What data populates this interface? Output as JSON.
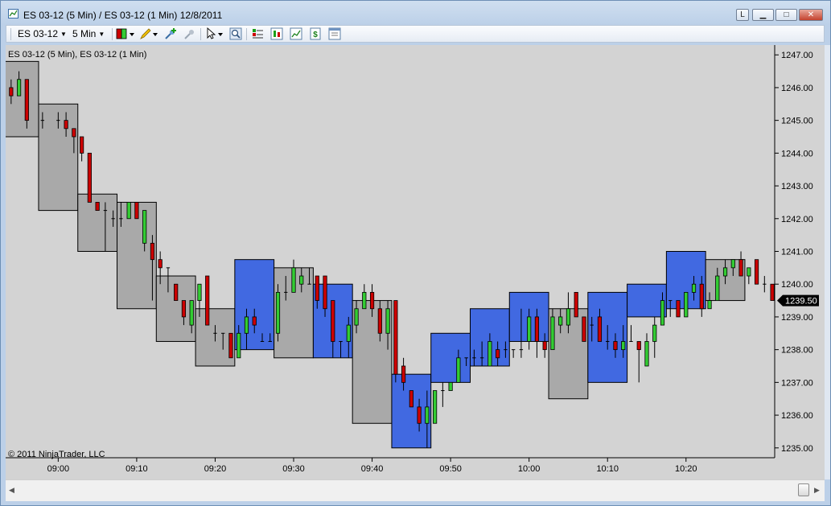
{
  "window": {
    "title": "ES 03-12 (5 Min) / ES 03-12 (1 Min)  12/8/2011",
    "buttons": {
      "link": "L",
      "minimize": "▁",
      "maximize": "□",
      "close": "✕"
    }
  },
  "toolbar": {
    "instrument": "ES 03-12",
    "interval": "5 Min",
    "icons": [
      "bar-style-icon",
      "pencil-drawing-icon",
      "add-indicator-icon",
      "remove-indicator-icon",
      "pointer-icon",
      "zoom-icon",
      "strategies-icon",
      "chart-trader-icon",
      "data-box-icon",
      "dollar-icon",
      "properties-icon"
    ]
  },
  "chart_data": {
    "type": "candlestick",
    "label": "ES 03-12 (5 Min), ES 03-12 (1 Min)",
    "copyright": "© 2011 NinjaTrader, LLC",
    "ylim": [
      1234.7,
      1247.3
    ],
    "y_ticks": [
      "1247.00",
      "1246.00",
      "1245.00",
      "1244.00",
      "1243.00",
      "1242.00",
      "1241.00",
      "1240.00",
      "1239.00",
      "1238.00",
      "1237.00",
      "1236.00",
      "1235.00"
    ],
    "x_ticks": [
      "09:00",
      "09:10",
      "09:20",
      "09:30",
      "09:40",
      "09:50",
      "10:00",
      "10:10",
      "10:20"
    ],
    "x_tick_minutes": [
      60,
      70,
      80,
      90,
      100,
      110,
      120,
      130,
      140
    ],
    "x_range_minutes": [
      53.3,
      151.3
    ],
    "last_price": "1239.50",
    "colors": {
      "up_block": "#4169e1",
      "down_block": "#a9a9a9",
      "up_candle": "#33cc33",
      "down_candle": "#cc0000",
      "background": "#d3d3d3"
    },
    "blocks": [
      {
        "t": 55,
        "o": 1246.0,
        "h": 1246.8,
        "l": 1244.5,
        "c": 1244.5
      },
      {
        "t": 60,
        "o": 1245.5,
        "h": 1245.5,
        "l": 1242.25,
        "c": 1242.25
      },
      {
        "t": 65,
        "o": 1242.75,
        "h": 1242.75,
        "l": 1241.0,
        "c": 1241.0
      },
      {
        "t": 70,
        "o": 1242.5,
        "h": 1242.5,
        "l": 1239.25,
        "c": 1239.25
      },
      {
        "t": 75,
        "o": 1240.25,
        "h": 1240.25,
        "l": 1238.25,
        "c": 1238.25
      },
      {
        "t": 80,
        "o": 1239.25,
        "h": 1239.25,
        "l": 1237.5,
        "c": 1237.5
      },
      {
        "t": 85,
        "o": 1238.0,
        "h": 1240.75,
        "l": 1238.0,
        "c": 1240.75
      },
      {
        "t": 90,
        "o": 1240.5,
        "h": 1240.5,
        "l": 1237.75,
        "c": 1237.75
      },
      {
        "t": 95,
        "o": 1237.75,
        "h": 1240.0,
        "l": 1237.75,
        "c": 1240.0
      },
      {
        "t": 100,
        "o": 1239.5,
        "h": 1239.5,
        "l": 1235.75,
        "c": 1235.75
      },
      {
        "t": 105,
        "o": 1235.0,
        "h": 1237.25,
        "l": 1235.0,
        "c": 1237.25
      },
      {
        "t": 110,
        "o": 1237.0,
        "h": 1238.5,
        "l": 1237.0,
        "c": 1238.5
      },
      {
        "t": 115,
        "o": 1237.5,
        "h": 1239.25,
        "l": 1237.5,
        "c": 1239.25
      },
      {
        "t": 120,
        "o": 1238.25,
        "h": 1239.75,
        "l": 1238.25,
        "c": 1239.75
      },
      {
        "t": 125,
        "o": 1239.25,
        "h": 1239.25,
        "l": 1236.5,
        "c": 1236.5
      },
      {
        "t": 130,
        "o": 1237.0,
        "h": 1239.75,
        "l": 1237.0,
        "c": 1239.75
      },
      {
        "t": 135,
        "o": 1239.0,
        "h": 1240.0,
        "l": 1239.0,
        "c": 1240.0
      },
      {
        "t": 140,
        "o": 1239.25,
        "h": 1241.0,
        "l": 1239.25,
        "c": 1241.0
      },
      {
        "t": 145,
        "o": 1240.75,
        "h": 1240.75,
        "l": 1239.5,
        "c": 1239.5
      }
    ],
    "candles": [
      {
        "t": 54,
        "o": 1246.0,
        "h": 1246.25,
        "l": 1245.5,
        "c": 1245.75
      },
      {
        "t": 55,
        "o": 1245.75,
        "h": 1246.5,
        "l": 1245.75,
        "c": 1246.25
      },
      {
        "t": 56,
        "o": 1246.25,
        "h": 1246.25,
        "l": 1244.75,
        "c": 1245.0
      },
      {
        "t": 58,
        "o": 1245.0,
        "h": 1245.25,
        "l": 1244.75,
        "c": 1245.0
      },
      {
        "t": 60,
        "o": 1245.0,
        "h": 1245.25,
        "l": 1244.75,
        "c": 1245.0
      },
      {
        "t": 61,
        "o": 1245.0,
        "h": 1245.25,
        "l": 1244.5,
        "c": 1244.75
      },
      {
        "t": 62,
        "o": 1244.75,
        "h": 1244.75,
        "l": 1244.0,
        "c": 1244.5
      },
      {
        "t": 63,
        "o": 1244.5,
        "h": 1244.5,
        "l": 1243.75,
        "c": 1244.0
      },
      {
        "t": 64,
        "o": 1244.0,
        "h": 1244.0,
        "l": 1242.5,
        "c": 1242.5
      },
      {
        "t": 65,
        "o": 1242.5,
        "h": 1242.5,
        "l": 1242.25,
        "c": 1242.25
      },
      {
        "t": 66,
        "o": 1242.25,
        "h": 1242.5,
        "l": 1241.0,
        "c": 1242.25
      },
      {
        "t": 67,
        "o": 1242.0,
        "h": 1242.25,
        "l": 1241.75,
        "c": 1242.0
      },
      {
        "t": 68,
        "o": 1242.0,
        "h": 1242.5,
        "l": 1241.75,
        "c": 1242.0
      },
      {
        "t": 69,
        "o": 1242.0,
        "h": 1242.5,
        "l": 1242.0,
        "c": 1242.5
      },
      {
        "t": 70,
        "o": 1242.5,
        "h": 1242.5,
        "l": 1242.0,
        "c": 1242.0
      },
      {
        "t": 71,
        "o": 1241.25,
        "h": 1242.25,
        "l": 1241.0,
        "c": 1242.25
      },
      {
        "t": 72,
        "o": 1241.25,
        "h": 1241.5,
        "l": 1239.5,
        "c": 1240.75
      },
      {
        "t": 73,
        "o": 1240.75,
        "h": 1241.0,
        "l": 1240.0,
        "c": 1240.5
      },
      {
        "t": 74,
        "o": 1240.5,
        "h": 1240.5,
        "l": 1239.75,
        "c": 1240.5
      },
      {
        "t": 75,
        "o": 1240.0,
        "h": 1240.0,
        "l": 1239.5,
        "c": 1239.5
      },
      {
        "t": 76,
        "o": 1239.5,
        "h": 1239.5,
        "l": 1238.75,
        "c": 1239.0
      },
      {
        "t": 77,
        "o": 1238.75,
        "h": 1239.5,
        "l": 1238.5,
        "c": 1239.5
      },
      {
        "t": 78,
        "o": 1239.5,
        "h": 1240.0,
        "l": 1239.0,
        "c": 1240.0
      },
      {
        "t": 79,
        "o": 1240.25,
        "h": 1240.25,
        "l": 1238.75,
        "c": 1238.75
      },
      {
        "t": 80,
        "o": 1238.5,
        "h": 1238.75,
        "l": 1238.25,
        "c": 1238.5
      },
      {
        "t": 81,
        "o": 1238.5,
        "h": 1238.5,
        "l": 1238.0,
        "c": 1238.5
      },
      {
        "t": 82,
        "o": 1238.5,
        "h": 1238.5,
        "l": 1237.75,
        "c": 1237.75
      },
      {
        "t": 83,
        "o": 1237.75,
        "h": 1238.75,
        "l": 1237.75,
        "c": 1238.5
      },
      {
        "t": 84,
        "o": 1238.5,
        "h": 1239.25,
        "l": 1238.0,
        "c": 1239.0
      },
      {
        "t": 85,
        "o": 1239.0,
        "h": 1239.25,
        "l": 1238.5,
        "c": 1238.75
      },
      {
        "t": 86,
        "o": 1238.25,
        "h": 1238.5,
        "l": 1238.25,
        "c": 1238.25
      },
      {
        "t": 87,
        "o": 1238.25,
        "h": 1238.5,
        "l": 1238.25,
        "c": 1238.25
      },
      {
        "t": 88,
        "o": 1238.5,
        "h": 1240.0,
        "l": 1238.25,
        "c": 1239.75
      },
      {
        "t": 89,
        "o": 1239.75,
        "h": 1240.25,
        "l": 1239.5,
        "c": 1239.75
      },
      {
        "t": 90,
        "o": 1239.75,
        "h": 1240.75,
        "l": 1239.75,
        "c": 1240.5
      },
      {
        "t": 91,
        "o": 1240.0,
        "h": 1240.5,
        "l": 1239.75,
        "c": 1240.25
      },
      {
        "t": 92,
        "o": 1240.0,
        "h": 1240.5,
        "l": 1240.0,
        "c": 1240.0
      },
      {
        "t": 93,
        "o": 1240.25,
        "h": 1240.25,
        "l": 1239.25,
        "c": 1239.5
      },
      {
        "t": 94,
        "o": 1240.25,
        "h": 1240.25,
        "l": 1239.0,
        "c": 1239.25
      },
      {
        "t": 95,
        "o": 1239.5,
        "h": 1239.5,
        "l": 1237.75,
        "c": 1238.25
      },
      {
        "t": 96,
        "o": 1238.25,
        "h": 1238.25,
        "l": 1237.75,
        "c": 1238.25
      },
      {
        "t": 97,
        "o": 1238.25,
        "h": 1239.0,
        "l": 1237.75,
        "c": 1238.75
      },
      {
        "t": 98,
        "o": 1238.75,
        "h": 1239.5,
        "l": 1238.5,
        "c": 1239.25
      },
      {
        "t": 99,
        "o": 1239.25,
        "h": 1240.0,
        "l": 1239.25,
        "c": 1239.75
      },
      {
        "t": 100,
        "o": 1239.75,
        "h": 1240.0,
        "l": 1239.0,
        "c": 1239.25
      },
      {
        "t": 101,
        "o": 1239.25,
        "h": 1239.5,
        "l": 1238.25,
        "c": 1238.5
      },
      {
        "t": 102,
        "o": 1238.5,
        "h": 1239.5,
        "l": 1238.0,
        "c": 1239.25
      },
      {
        "t": 103,
        "o": 1239.5,
        "h": 1239.5,
        "l": 1237.0,
        "c": 1237.25
      },
      {
        "t": 104,
        "o": 1237.5,
        "h": 1237.75,
        "l": 1236.75,
        "c": 1237.0
      },
      {
        "t": 105,
        "o": 1236.75,
        "h": 1236.75,
        "l": 1236.25,
        "c": 1236.25
      },
      {
        "t": 106,
        "o": 1236.25,
        "h": 1236.5,
        "l": 1235.5,
        "c": 1235.75
      },
      {
        "t": 107,
        "o": 1235.75,
        "h": 1236.75,
        "l": 1235.0,
        "c": 1236.25
      },
      {
        "t": 108,
        "o": 1235.75,
        "h": 1236.75,
        "l": 1235.75,
        "c": 1236.75
      },
      {
        "t": 109,
        "o": 1236.75,
        "h": 1237.0,
        "l": 1236.25,
        "c": 1236.75
      },
      {
        "t": 110,
        "o": 1236.75,
        "h": 1237.0,
        "l": 1236.75,
        "c": 1237.0
      },
      {
        "t": 111,
        "o": 1237.0,
        "h": 1238.0,
        "l": 1237.0,
        "c": 1237.75
      },
      {
        "t": 112,
        "o": 1237.75,
        "h": 1237.75,
        "l": 1237.5,
        "c": 1237.75
      },
      {
        "t": 113,
        "o": 1237.75,
        "h": 1238.0,
        "l": 1237.5,
        "c": 1237.75
      },
      {
        "t": 114,
        "o": 1237.75,
        "h": 1238.25,
        "l": 1237.5,
        "c": 1237.75
      },
      {
        "t": 115,
        "o": 1237.5,
        "h": 1238.5,
        "l": 1237.5,
        "c": 1238.25
      },
      {
        "t": 116,
        "o": 1238.0,
        "h": 1238.25,
        "l": 1237.5,
        "c": 1237.75
      },
      {
        "t": 117,
        "o": 1238.0,
        "h": 1238.25,
        "l": 1237.75,
        "c": 1238.0
      },
      {
        "t": 118,
        "o": 1238.0,
        "h": 1238.0,
        "l": 1237.75,
        "c": 1238.0
      },
      {
        "t": 119,
        "o": 1238.0,
        "h": 1239.25,
        "l": 1237.75,
        "c": 1238.0
      },
      {
        "t": 120,
        "o": 1238.25,
        "h": 1239.25,
        "l": 1238.0,
        "c": 1239.0
      },
      {
        "t": 121,
        "o": 1239.0,
        "h": 1239.25,
        "l": 1237.75,
        "c": 1238.25
      },
      {
        "t": 122,
        "o": 1238.25,
        "h": 1238.5,
        "l": 1237.75,
        "c": 1238.0
      },
      {
        "t": 123,
        "o": 1238.0,
        "h": 1239.25,
        "l": 1238.0,
        "c": 1239.0
      },
      {
        "t": 124,
        "o": 1238.75,
        "h": 1239.25,
        "l": 1238.5,
        "c": 1239.0
      },
      {
        "t": 125,
        "o": 1238.75,
        "h": 1239.75,
        "l": 1238.5,
        "c": 1239.25
      },
      {
        "t": 126,
        "o": 1239.75,
        "h": 1239.75,
        "l": 1239.0,
        "c": 1239.0
      },
      {
        "t": 127,
        "o": 1239.0,
        "h": 1239.0,
        "l": 1238.25,
        "c": 1238.25
      },
      {
        "t": 128,
        "o": 1238.75,
        "h": 1239.0,
        "l": 1238.25,
        "c": 1238.75
      },
      {
        "t": 129,
        "o": 1239.0,
        "h": 1239.25,
        "l": 1238.25,
        "c": 1238.25
      },
      {
        "t": 130,
        "o": 1238.25,
        "h": 1238.75,
        "l": 1238.0,
        "c": 1238.25
      },
      {
        "t": 131,
        "o": 1238.25,
        "h": 1238.5,
        "l": 1237.75,
        "c": 1238.0
      },
      {
        "t": 132,
        "o": 1238.0,
        "h": 1238.75,
        "l": 1237.75,
        "c": 1238.25
      },
      {
        "t": 133,
        "o": 1238.25,
        "h": 1238.75,
        "l": 1238.25,
        "c": 1238.25
      },
      {
        "t": 134,
        "o": 1238.25,
        "h": 1238.25,
        "l": 1237.0,
        "c": 1238.0
      },
      {
        "t": 135,
        "o": 1237.5,
        "h": 1238.5,
        "l": 1237.5,
        "c": 1238.25
      },
      {
        "t": 136,
        "o": 1238.25,
        "h": 1239.0,
        "l": 1237.75,
        "c": 1238.75
      },
      {
        "t": 137,
        "o": 1238.75,
        "h": 1239.75,
        "l": 1238.75,
        "c": 1239.5
      },
      {
        "t": 138,
        "o": 1239.5,
        "h": 1239.5,
        "l": 1239.0,
        "c": 1239.5
      },
      {
        "t": 139,
        "o": 1239.5,
        "h": 1239.5,
        "l": 1239.0,
        "c": 1239.0
      },
      {
        "t": 140,
        "o": 1239.0,
        "h": 1239.75,
        "l": 1239.0,
        "c": 1239.75
      },
      {
        "t": 141,
        "o": 1239.75,
        "h": 1240.25,
        "l": 1239.5,
        "c": 1240.0
      },
      {
        "t": 142,
        "o": 1240.0,
        "h": 1240.25,
        "l": 1239.0,
        "c": 1239.25
      },
      {
        "t": 143,
        "o": 1239.25,
        "h": 1239.75,
        "l": 1239.25,
        "c": 1239.5
      },
      {
        "t": 144,
        "o": 1239.5,
        "h": 1240.5,
        "l": 1239.5,
        "c": 1240.25
      },
      {
        "t": 145,
        "o": 1240.25,
        "h": 1240.75,
        "l": 1240.0,
        "c": 1240.5
      },
      {
        "t": 146,
        "o": 1240.5,
        "h": 1240.75,
        "l": 1240.25,
        "c": 1240.75
      },
      {
        "t": 147,
        "o": 1240.75,
        "h": 1241.0,
        "l": 1240.25,
        "c": 1240.25
      },
      {
        "t": 148,
        "o": 1240.25,
        "h": 1240.5,
        "l": 1240.0,
        "c": 1240.5
      },
      {
        "t": 149,
        "o": 1240.75,
        "h": 1240.75,
        "l": 1240.0,
        "c": 1240.0
      },
      {
        "t": 150,
        "o": 1240.0,
        "h": 1240.25,
        "l": 1239.75,
        "c": 1240.0
      },
      {
        "t": 151,
        "o": 1240.0,
        "h": 1240.0,
        "l": 1239.5,
        "c": 1239.5
      }
    ]
  }
}
